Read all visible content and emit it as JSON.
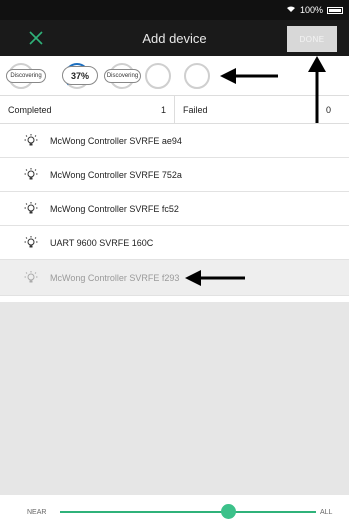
{
  "status_bar": {
    "battery_text": "100%"
  },
  "header": {
    "title": "Add device",
    "done_label": "DONE"
  },
  "discovery": {
    "left_label": "Discovering",
    "progress": "37%",
    "right_label": "Discovering"
  },
  "stats": {
    "completed_label": "Completed",
    "completed_count": "1",
    "failed_label": "Failed",
    "failed_count": "0"
  },
  "devices": [
    {
      "name": "McWong Controller SVRFE ae94"
    },
    {
      "name": "McWong Controller SVRFE 752a"
    },
    {
      "name": "McWong Controller SVRFE fc52"
    },
    {
      "name": "UART 9600 SVRFE 160C"
    },
    {
      "name": "McWong Controller SVRFE f293"
    }
  ],
  "range_slider": {
    "left_label": "NEAR",
    "right_label": "ALL",
    "value": 0.66
  },
  "colors": {
    "accent": "#3cc18a",
    "header_bg": "#1a1a1a",
    "close_icon": "#2fb27a"
  }
}
